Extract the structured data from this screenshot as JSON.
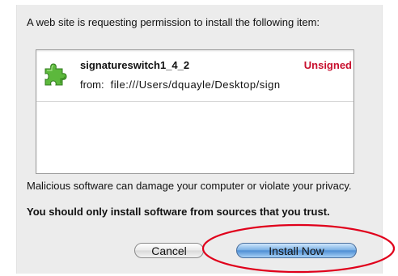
{
  "dialog": {
    "intro_text": "A web site is requesting permission to install the following item:",
    "item": {
      "icon": "puzzle-piece-icon",
      "name": "signatureswitch1_4_2",
      "status": "Unsigned",
      "from_label": "from:",
      "from_url": "file:///Users/dquayle/Desktop/sign"
    },
    "warning_text": "Malicious software can damage your computer or violate your privacy.",
    "advice_text": "You should only install software from sources that you trust.",
    "buttons": {
      "cancel_label": "Cancel",
      "install_label": "Install Now"
    }
  },
  "colors": {
    "unsigned_status": "#c8102e",
    "highlight_circle": "#e0001b",
    "install_button": "#5b9bdc",
    "dialog_background": "#ececec"
  }
}
